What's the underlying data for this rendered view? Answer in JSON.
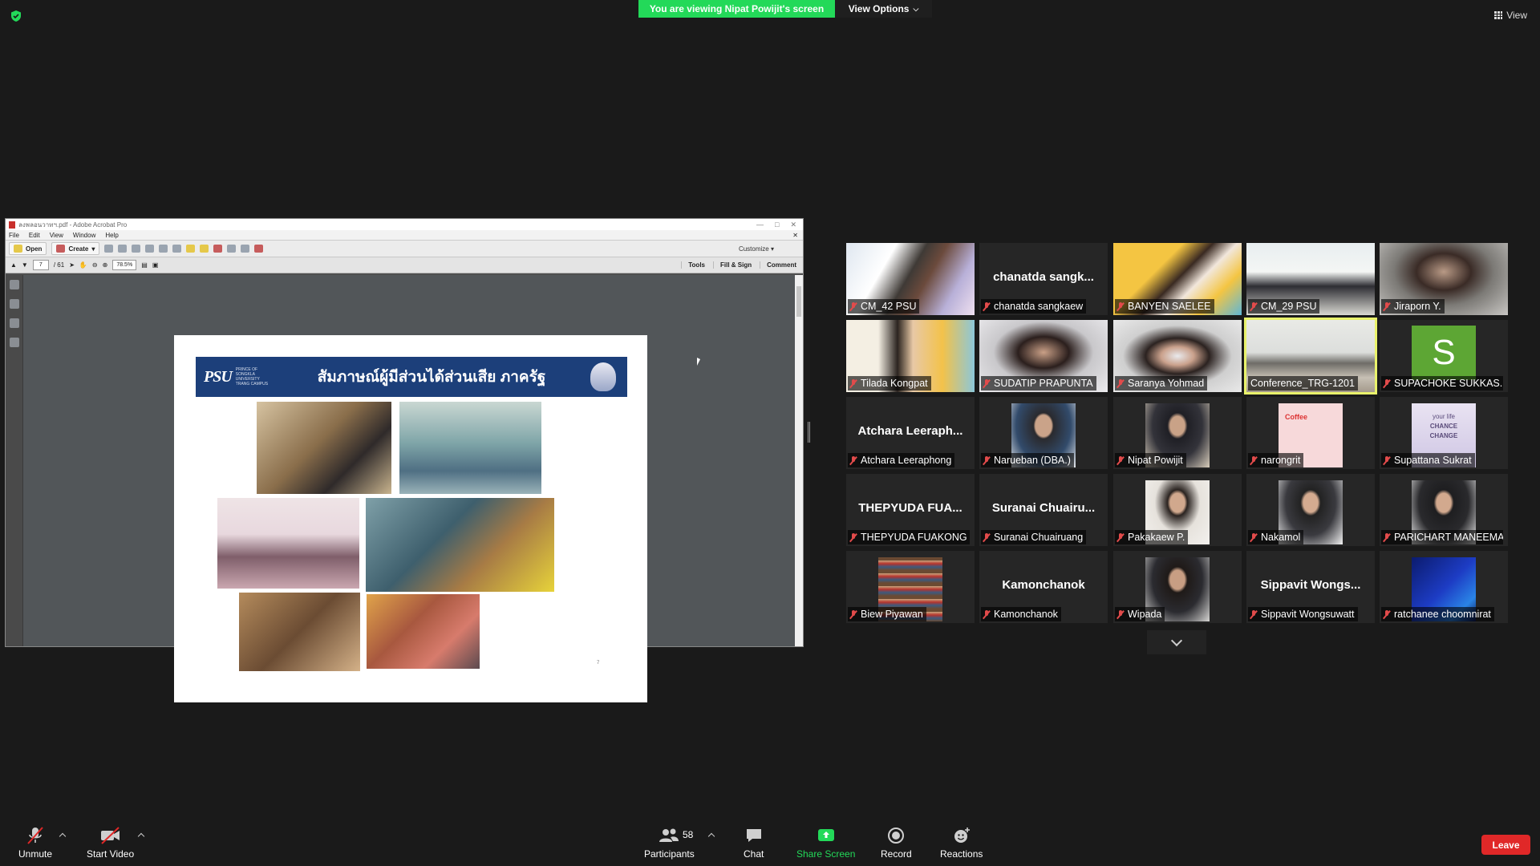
{
  "banner": {
    "viewing_text": "You are viewing Nipat Powijit's screen",
    "view_options": "View Options",
    "view": "View"
  },
  "acrobat": {
    "title": "ลงพลอนวาทฯ.pdf - Adobe Acrobat Pro",
    "menu": [
      "File",
      "Edit",
      "View",
      "Window",
      "Help"
    ],
    "open_label": "Open",
    "create_label": "Create",
    "customize_label": "Customize",
    "page_current": "7",
    "page_total": "/ 61",
    "zoom": "78.5%",
    "tools_label": "Tools",
    "fill_sign_label": "Fill & Sign",
    "comment_label": "Comment"
  },
  "slide": {
    "title": "สัมภาษณ์ผู้มีส่วนได้ส่วนเสีย ภาครัฐ",
    "logo_text": "PSU",
    "logo_sub": "PRINCE OF SONGKLA UNIVERSITY TRANG CAMPUS",
    "page_number": "7"
  },
  "participants": [
    {
      "name": "CM_42 PSU",
      "big": "",
      "kind": "video"
    },
    {
      "name": "chanatda sangkaew",
      "big": "chanatda sangk...",
      "kind": "name"
    },
    {
      "name": "BANYEN SAELEE",
      "big": "",
      "kind": "video"
    },
    {
      "name": "CM_29 PSU",
      "big": "",
      "kind": "video"
    },
    {
      "name": "Jiraporn Y.",
      "big": "",
      "kind": "video"
    },
    {
      "name": "Tilada Kongpat",
      "big": "",
      "kind": "video"
    },
    {
      "name": "SUDATIP PRAPUNTA",
      "big": "",
      "kind": "video"
    },
    {
      "name": "Saranya Yohmad",
      "big": "",
      "kind": "video"
    },
    {
      "name": "Conference_TRG-1201",
      "big": "",
      "kind": "video"
    },
    {
      "name": "SUPACHOKE SUKKAS...",
      "big": "S",
      "kind": "avatar"
    },
    {
      "name": "Atchara Leeraphong",
      "big": "Atchara Leeraph...",
      "kind": "name"
    },
    {
      "name": "Narueban (DBA.)",
      "big": "",
      "kind": "photo"
    },
    {
      "name": "Nipat Powijit",
      "big": "",
      "kind": "photo"
    },
    {
      "name": "narongrit",
      "big": "",
      "kind": "photo"
    },
    {
      "name": "Supattana Sukrat",
      "big": "",
      "kind": "photo"
    },
    {
      "name": "THEPYUDA FUAKONG",
      "big": "THEPYUDA FUA...",
      "kind": "name"
    },
    {
      "name": "Suranai Chuairuang",
      "big": "Suranai Chuairu...",
      "kind": "name"
    },
    {
      "name": "Pakakaew P.",
      "big": "",
      "kind": "photo"
    },
    {
      "name": "Nakamol",
      "big": "",
      "kind": "photo"
    },
    {
      "name": "PARICHART MANEEMAI",
      "big": "",
      "kind": "photo"
    },
    {
      "name": "Biew Piyawan",
      "big": "",
      "kind": "photo"
    },
    {
      "name": "Kamonchanok",
      "big": "Kamonchanok",
      "kind": "name"
    },
    {
      "name": "Wipada",
      "big": "",
      "kind": "photo"
    },
    {
      "name": "Sippavit Wongsuwatt",
      "big": "Sippavit Wongs...",
      "kind": "name"
    },
    {
      "name": "ratchanee choomnirat",
      "big": "",
      "kind": "photo"
    }
  ],
  "tile_art": {
    "coffee_line": "Coffee",
    "quote_line1": "your life",
    "quote_line2": "CHANCE",
    "quote_line3": "CHANGE"
  },
  "toolbar": {
    "unmute": "Unmute",
    "start_video": "Start Video",
    "participants": "Participants",
    "participants_count": "58",
    "chat": "Chat",
    "share_screen": "Share Screen",
    "record": "Record",
    "reactions": "Reactions",
    "leave": "Leave"
  },
  "colors": {
    "green": "#23d959",
    "leave_red": "#e02828",
    "active_border": "#e9f26b",
    "slide_header": "#1c3f7a"
  }
}
